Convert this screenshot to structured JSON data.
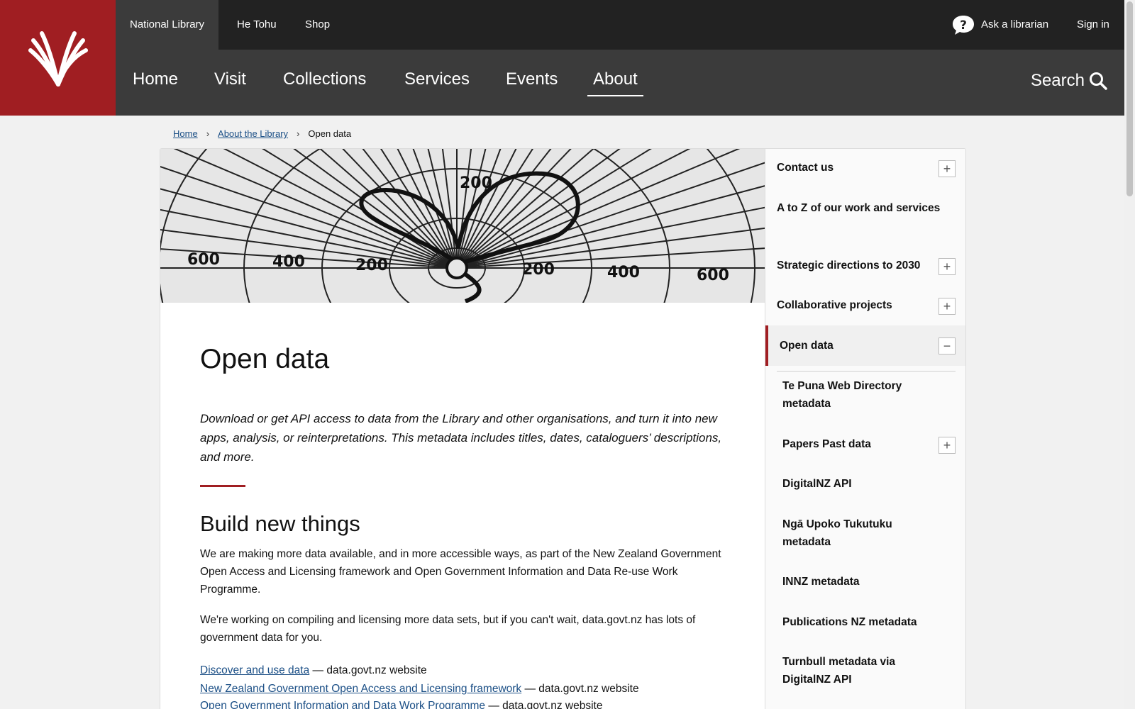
{
  "utility_nav": {
    "items": [
      "National Library",
      "He Tohu",
      "Shop"
    ],
    "ask_librarian": "Ask a librarian",
    "sign_in": "Sign in"
  },
  "main_nav": {
    "items": [
      "Home",
      "Visit",
      "Collections",
      "Services",
      "Events",
      "About"
    ],
    "active": "About",
    "search": "Search"
  },
  "breadcrumb": [
    "Home",
    "About the Library",
    "Open data"
  ],
  "hero_image": {
    "labels": [
      "200",
      "600",
      "400",
      "200",
      "200",
      "400",
      "600"
    ]
  },
  "page": {
    "title": "Open data",
    "lead": "Download or get API access to data from the Library and other organisations, and turn it into new apps, analysis, or reinterpretations. This metadata includes titles, dates, cataloguers’ descriptions, and more.",
    "section_title": "Build new things",
    "para1": "We are making more data available, and in more accessible ways, as part of the New Zealand Government Open Access and Licensing framework and Open Government Information and Data Re-use Work Programme.",
    "para2": "We're working on compiling and licensing more data sets, but if you can't wait, data.govt.nz has lots of government data for you.",
    "links": [
      {
        "text": "Discover and use data",
        "suffix": " — data.govt.nz website"
      },
      {
        "text": "New Zealand Government Open Access and Licensing framework",
        "suffix": " — data.govt.nz website"
      },
      {
        "text": "Open Government Information and Data Work Programme",
        "suffix": " — data.govt.nz website"
      }
    ]
  },
  "sidebar": {
    "items": [
      {
        "label": "Contact us",
        "toggle": "+"
      },
      {
        "label": "A to Z of our work and services"
      },
      {
        "label": "Strategic directions to 2030",
        "toggle": "+"
      },
      {
        "label": "Collaborative projects",
        "toggle": "+"
      },
      {
        "label": "Open data",
        "toggle": "−"
      }
    ],
    "sub_items": [
      {
        "label": "Te Puna Web Directory metadata"
      },
      {
        "label": "Papers Past data",
        "toggle": "+"
      },
      {
        "label": "DigitalNZ API"
      },
      {
        "label": "Ngā Upoko Tukutuku metadata"
      },
      {
        "label": "INNZ metadata"
      },
      {
        "label": "Publications NZ metadata"
      },
      {
        "label": "Turnbull metadata via DigitalNZ API"
      }
    ]
  },
  "colors": {
    "brand_red": "#a01e22",
    "top_bar": "#222222",
    "nav_bar": "#3b3b3b",
    "link": "#1b4f86"
  }
}
